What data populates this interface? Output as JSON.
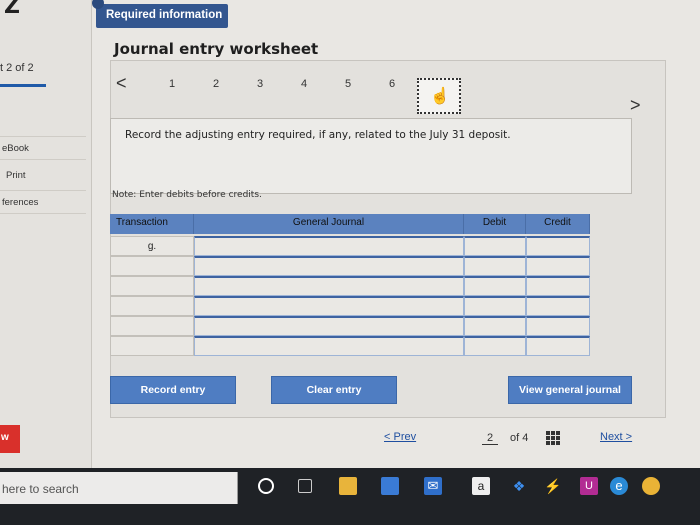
{
  "sidebar": {
    "part_label": "t 2 of 2",
    "links": [
      "eBook",
      "Print",
      "ferences"
    ],
    "red_tab": "w"
  },
  "worksheet": {
    "required_tab": "Required information",
    "title": "Journal entry worksheet",
    "nav": {
      "prev": "<",
      "next": ">",
      "numbers": [
        "1",
        "2",
        "3",
        "4",
        "5",
        "6"
      ]
    },
    "instruction": "Record the adjusting entry required, if any, related to the July 31 deposit.",
    "note": "Note: Enter debits before credits."
  },
  "journal": {
    "headers": {
      "transaction": "Transaction",
      "general_journal": "General Journal",
      "debit": "Debit",
      "credit": "Credit"
    },
    "rows": [
      {
        "transaction": "g.",
        "account": "",
        "debit": "",
        "credit": ""
      },
      {
        "transaction": "",
        "account": "",
        "debit": "",
        "credit": ""
      },
      {
        "transaction": "",
        "account": "",
        "debit": "",
        "credit": ""
      },
      {
        "transaction": "",
        "account": "",
        "debit": "",
        "credit": ""
      },
      {
        "transaction": "",
        "account": "",
        "debit": "",
        "credit": ""
      },
      {
        "transaction": "",
        "account": "",
        "debit": "",
        "credit": ""
      }
    ]
  },
  "buttons": {
    "record": "Record entry",
    "clear": "Clear entry",
    "view": "View general journal"
  },
  "pager": {
    "prev": "< Prev",
    "current": "2",
    "of": "of 4",
    "next": "Next >"
  },
  "taskbar": {
    "search_placeholder": "here to search",
    "amazon_letter": "a"
  },
  "colors": {
    "accent": "#4f7dc2",
    "header_blue": "#5b82bf",
    "required_tab": "#33568f",
    "red_tab": "#d9302b"
  }
}
